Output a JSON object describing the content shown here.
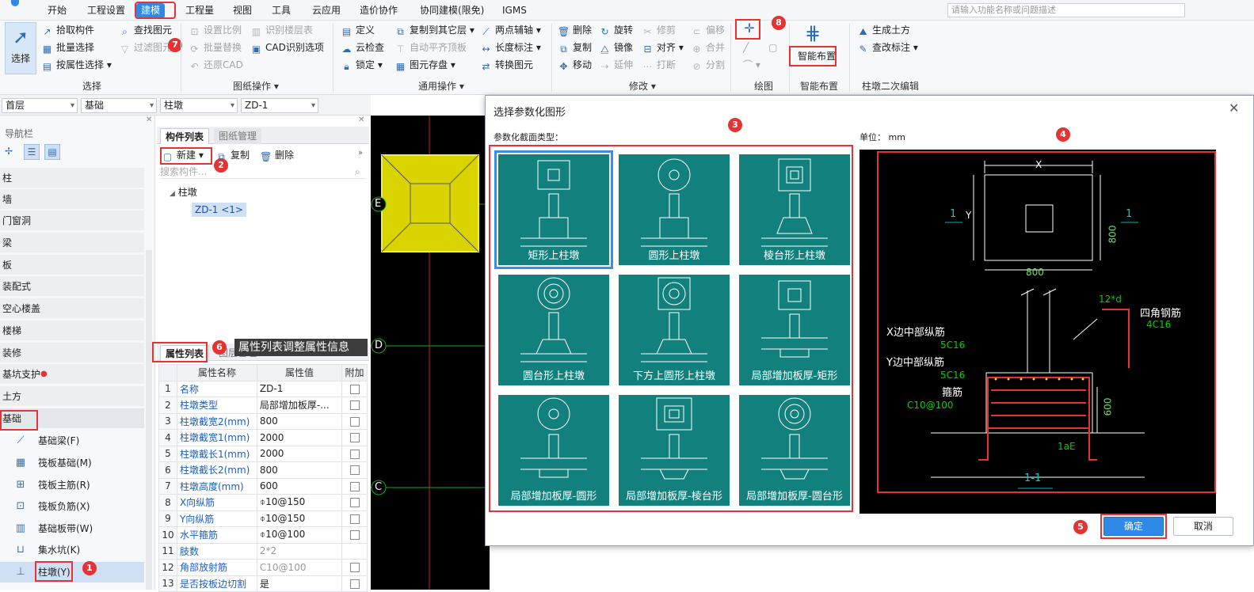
{
  "menubar": {
    "items": [
      "开始",
      "工程设置",
      "建模",
      "工程量",
      "视图",
      "工具",
      "云应用",
      "造价协作",
      "协同建模(限免)",
      "IGMS"
    ],
    "active": "建模",
    "search_placeholder": "请输入功能名称或问题描述"
  },
  "ribbon": {
    "select_big": "选择",
    "select_items": [
      "拾取构件",
      "批量选择",
      "按属性选择"
    ],
    "find_items": [
      "查找图元",
      "过滤图元"
    ],
    "drawing_items": [
      "设置比例",
      "批量替换",
      "还原CAD",
      "识别楼层表",
      "CAD识别选项"
    ],
    "general_items": [
      "定义",
      "云检查",
      "锁定",
      "复制到其它层",
      "自动平齐顶板",
      "图元存盘",
      "两点辅轴",
      "长度标注",
      "转换图元"
    ],
    "modify_items": [
      "删除",
      "复制",
      "移动",
      "旋转",
      "镜像",
      "延伸",
      "修剪",
      "对齐",
      "打断",
      "偏移",
      "合并",
      "分割"
    ],
    "smart_layout": "智能布置",
    "secondary_items": [
      "生成土方",
      "查改标注"
    ],
    "group_labels": [
      "选择",
      "图纸操作",
      "通用操作",
      "修改",
      "绘图",
      "智能布置",
      "柱墩二次编辑"
    ]
  },
  "combos": [
    "首层",
    "基础",
    "柱墩",
    "ZD-1"
  ],
  "nav": {
    "title": "导航栏",
    "items": [
      "柱",
      "墙",
      "门窗洞",
      "梁",
      "板",
      "装配式",
      "空心楼盖",
      "楼梯",
      "装修",
      "基坑支护",
      "土方",
      "基础"
    ],
    "sub_items": [
      "基础梁(F)",
      "筏板基础(M)",
      "筏板主筋(R)",
      "筏板负筋(X)",
      "基础板带(W)",
      "集水坑(K)",
      "柱墩(Y)"
    ]
  },
  "component_panel": {
    "tabs": [
      "构件列表",
      "图纸管理"
    ],
    "new": "新建",
    "copy": "复制",
    "delete": "删除",
    "search_placeholder": "搜索构件...",
    "tree_parent": "柱墩",
    "tree_child": "ZD-1 <1>"
  },
  "props_panel": {
    "tabs": [
      "属性列表",
      "图层管理"
    ],
    "headers": [
      "属性名称",
      "属性值",
      "附加"
    ],
    "rows": [
      {
        "n": "1",
        "k": "名称",
        "v": "ZD-1"
      },
      {
        "n": "2",
        "k": "柱墩类型",
        "v": "局部增加板厚-..."
      },
      {
        "n": "3",
        "k": "柱墩截宽2(mm)",
        "v": "800"
      },
      {
        "n": "4",
        "k": "柱墩截宽1(mm)",
        "v": "2000"
      },
      {
        "n": "5",
        "k": "柱墩截长1(mm)",
        "v": "2000"
      },
      {
        "n": "6",
        "k": "柱墩截长2(mm)",
        "v": "800"
      },
      {
        "n": "7",
        "k": "柱墩高度(mm)",
        "v": "600"
      },
      {
        "n": "8",
        "k": "X向纵筋",
        "v": "⌽10@150"
      },
      {
        "n": "9",
        "k": "Y向纵筋",
        "v": "⌽10@150"
      },
      {
        "n": "10",
        "k": "水平箍筋",
        "v": "⌽10@100"
      },
      {
        "n": "11",
        "k": "肢数",
        "v": "2*2"
      },
      {
        "n": "12",
        "k": "角部放射筋",
        "v": "C10@100"
      },
      {
        "n": "13",
        "k": "是否按板边切割",
        "v": "是"
      }
    ],
    "tooltip": "属性列表调整属性信息"
  },
  "cad_axes": [
    "E",
    "D",
    "C"
  ],
  "dialog": {
    "title": "选择参数化图形",
    "section_label": "参数化截面类型：",
    "unit_label": "单位：  mm",
    "tiles": [
      "矩形上柱墩",
      "圆形上柱墩",
      "棱台形上柱墩",
      "圆台形上柱墩",
      "下方上圆形上柱墩",
      "局部增加板厚-矩形",
      "局部增加板厚-圆形",
      "局部增加板厚-棱台形",
      "局部增加板厚-圆台形"
    ],
    "ok": "确定",
    "cancel": "取消",
    "preview": {
      "dim_x": "X",
      "dim_y": "Y",
      "dim_800h": "800",
      "dim_800v": "800",
      "sec_1": "1",
      "x_mid": "X边中部纵筋",
      "x_mid_v": "5C16",
      "y_mid": "Y边中部纵筋",
      "y_mid_v": "5C16",
      "stirrup": "箍筋",
      "stirrup_v": "C10@100",
      "corner": "四角钢筋",
      "corner_v": "4C16",
      "d12": "12*d",
      "h600": "600",
      "lae": "1aE",
      "section": "1-1"
    }
  },
  "badges": [
    "1",
    "2",
    "3",
    "4",
    "5",
    "6",
    "7",
    "8"
  ],
  "colors": {
    "accent": "#2e8ae6",
    "tile": "#12807c",
    "annot": "#e53333"
  }
}
